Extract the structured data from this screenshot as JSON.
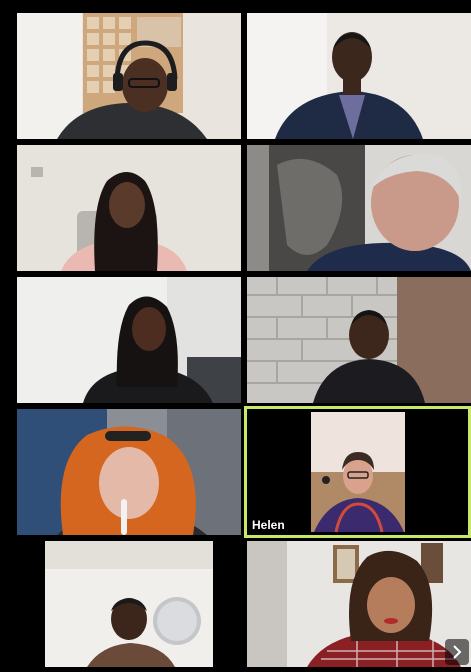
{
  "participants": [
    {
      "id": "p1",
      "name": "",
      "icon": "video-feed-person-headset"
    },
    {
      "id": "p2",
      "name": "",
      "icon": "video-feed-person-suit"
    },
    {
      "id": "p3",
      "name": "",
      "icon": "video-feed-person"
    },
    {
      "id": "p4",
      "name": "",
      "icon": "video-feed-person-closeup"
    },
    {
      "id": "p5",
      "name": "",
      "icon": "video-feed-person"
    },
    {
      "id": "p6",
      "name": "",
      "icon": "video-feed-person-hoodie"
    },
    {
      "id": "p7",
      "name": "",
      "icon": "video-feed-person-red-hair"
    },
    {
      "id": "p8",
      "name": "Helen",
      "icon": "video-feed-person",
      "active_speaker": true
    },
    {
      "id": "p9",
      "name": "",
      "icon": "video-feed-person"
    },
    {
      "id": "p10",
      "name": "",
      "icon": "video-feed-person"
    }
  ],
  "controls": {
    "next_page_icon": "chevron-right-icon"
  },
  "colors": {
    "active_speaker_border": "#c7e86b",
    "background": "#000000"
  }
}
